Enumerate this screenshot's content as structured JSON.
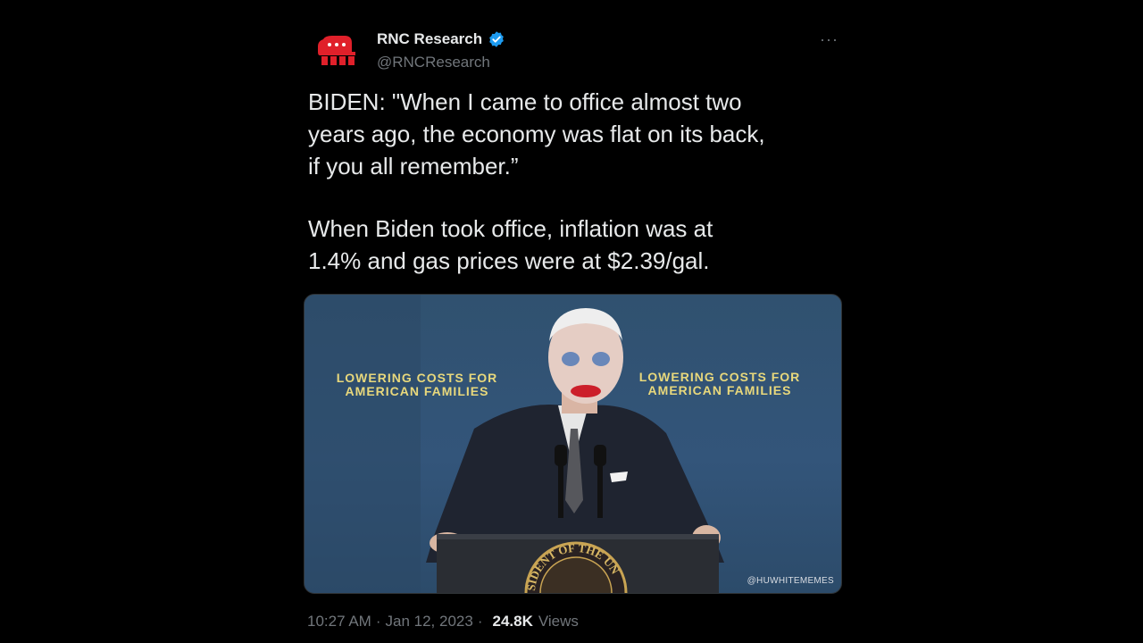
{
  "author": {
    "display_name": "RNC Research",
    "handle": "@RNCResearch",
    "verified": true,
    "avatar_icon": "republican-elephant-icon"
  },
  "more_icon": "ellipsis-icon",
  "tweet": {
    "paragraph_1": "BIDEN: \"When I came to office almost two\nyears ago, the economy was flat on its back,\nif you all remember.”",
    "paragraph_2": "When Biden took office, inflation was at\n1.4% and gas prices were at $2.39/gal."
  },
  "media": {
    "banner_left_line1": "Lowering Costs for",
    "banner_left_line2": "American Families",
    "banner_right_line1": "Lowering Costs for",
    "banner_right_line2": "American Families",
    "watermark": "@HUWHITEMEMES",
    "seal_text": "SIDENT OF THE UN"
  },
  "meta": {
    "time": "10:27 AM",
    "separator": "·",
    "date": "Jan 12, 2023",
    "views_count": "24.8K",
    "views_label": "Views"
  },
  "colors": {
    "background": "#000000",
    "text": "#e7e9ea",
    "secondary": "#71767b",
    "verified": "#1d9bf0",
    "elephant": "#e0202a",
    "banner_text": "#e8d87c"
  }
}
